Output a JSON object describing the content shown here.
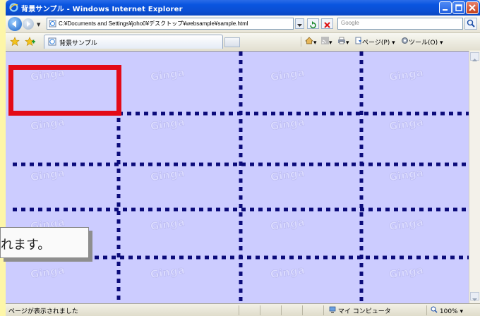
{
  "window": {
    "title": "背景サンプル - Windows Internet Explorer"
  },
  "address_bar": {
    "url": "C:¥Documents and Settings¥joho0¥デスクトップ¥websample¥sample.html",
    "search_placeholder": "Google"
  },
  "tab": {
    "label": "背景サンプル"
  },
  "commands": {
    "home": "▾",
    "feeds": "▾",
    "print": "▾",
    "page": "ページ(P) ▾",
    "tools": "ツール(O) ▾"
  },
  "page": {
    "watermark_text": "Ginga",
    "background_color": "#ccccff",
    "grid_line_color": "#0b0b7a",
    "highlight_color": "#e30a17"
  },
  "callout": {
    "text": "れます。"
  },
  "status": {
    "text": "ページが表示されました",
    "zone": "マイ コンピュータ",
    "zoom": "100%"
  }
}
